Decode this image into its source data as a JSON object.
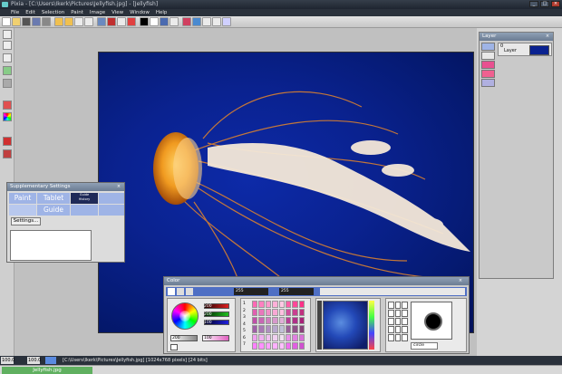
{
  "app": {
    "title": "Pixia - [C:\\Users\\Ikerk\\Pictures\\Jellyfish.jpg] - [Jellyfish] ",
    "window_buttons": [
      "_",
      "□",
      "×"
    ]
  },
  "menu": [
    "File",
    "Edit",
    "Selection",
    "Paint",
    "Image",
    "View",
    "Window",
    "Help"
  ],
  "layer_panel": {
    "title": "Layer",
    "close_label": "×",
    "layer_number": "0",
    "layer_name": "Layer"
  },
  "supplementary": {
    "title": "Supplementary Settings",
    "close_label": "×",
    "tabs": [
      {
        "label": "Paint"
      },
      {
        "label": "Tablet"
      },
      {
        "label": "Guide\nHistory"
      },
      {
        "label": "Guide"
      }
    ],
    "settings_button": "Settings..."
  },
  "color_panel": {
    "title": "Color",
    "close_label": "×",
    "toolbar_fields": [
      "255",
      "255"
    ],
    "sliders": [
      {
        "label": "R",
        "value": "200",
        "color": "#e02020"
      },
      {
        "label": "G",
        "value": "200",
        "color": "#20c020"
      },
      {
        "label": "B",
        "value": "100",
        "color": "#2020e0"
      }
    ],
    "hue_value": "200",
    "sat_value": "100",
    "palette_row_numbers": [
      "1",
      "2",
      "3",
      "4",
      "5",
      "6",
      "7"
    ],
    "palette_colors": [
      "#ff6ab4",
      "#ff80c0",
      "#ff98cc",
      "#ffb0d8",
      "#ffc8e4",
      "#ff60a8",
      "#ff4898",
      "#ff3088",
      "#e060b0",
      "#e878bc",
      "#f090c8",
      "#f8a8d4",
      "#ffc0e0",
      "#d050a0",
      "#c84090",
      "#c03080",
      "#c050a8",
      "#c868b4",
      "#d080c0",
      "#d898cc",
      "#e0b0d8",
      "#b84098",
      "#b03088",
      "#a82078",
      "#a060a8",
      "#a878b4",
      "#b090c0",
      "#b8a8cc",
      "#c0c0d8",
      "#986098",
      "#905088",
      "#884078",
      "#f0a0f0",
      "#f0b0f0",
      "#f0c0f0",
      "#f0d0f0",
      "#f0e0f0",
      "#e890e8",
      "#e080e0",
      "#d870d8",
      "#ff80ff",
      "#ff90ff",
      "#ffa0ff",
      "#ffb0ff",
      "#ffc0ff",
      "#f070f0",
      "#e060e0",
      "#d050d0"
    ],
    "brush_name": "circle"
  },
  "status": {
    "zoom": "100.0",
    "zoom2": "100.0",
    "file_info": "[C:\\Users\\Ikerk\\Pictures\\Jellyfish.jpg] [1024x768 pixels] [24 bits]"
  },
  "tabs": [
    "Jellyfish.jpg"
  ]
}
